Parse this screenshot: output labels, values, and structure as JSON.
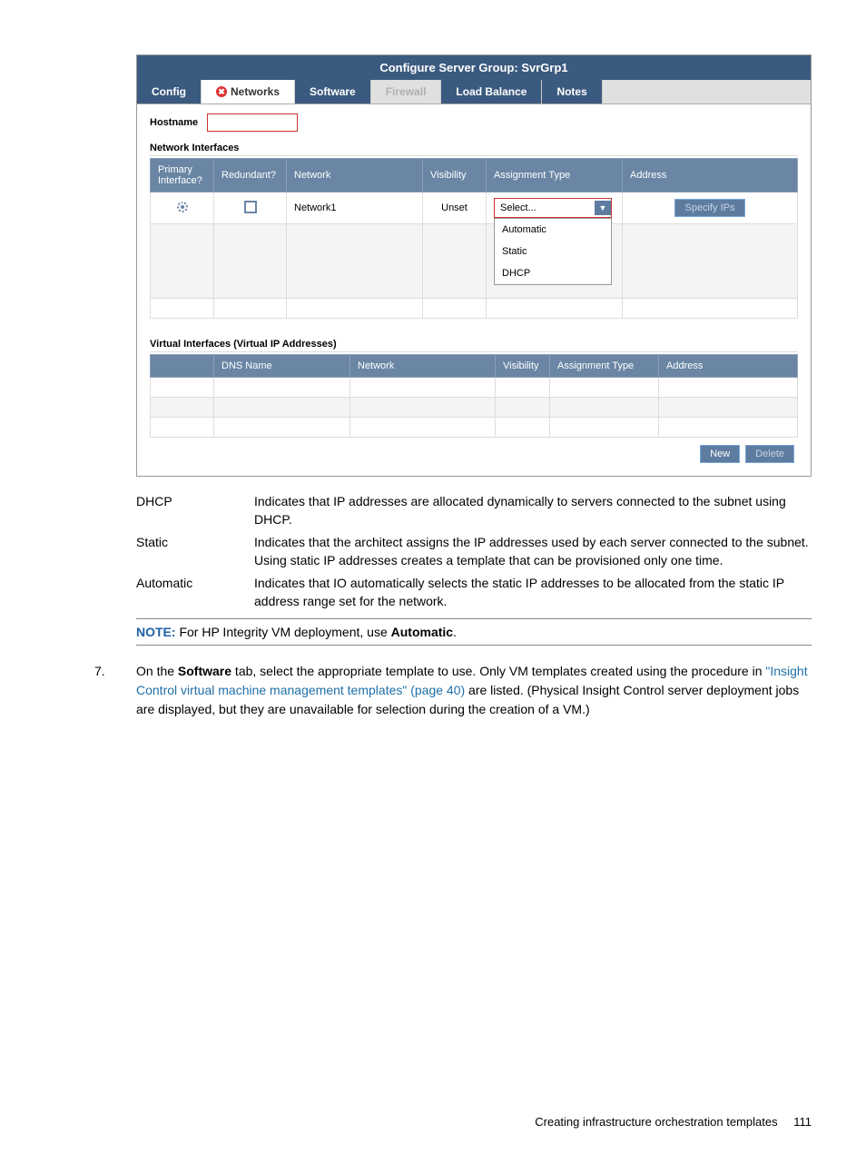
{
  "screenshot": {
    "title": "Configure Server Group: SvrGrp1",
    "tabs": {
      "config": "Config",
      "networks": "Networks",
      "software": "Software",
      "firewall": "Firewall",
      "loadbalance": "Load Balance",
      "notes": "Notes"
    },
    "hostname_label": "Hostname",
    "ni": {
      "title": "Network Interfaces",
      "headers": {
        "primary": "Primary Interface?",
        "redundant": "Redundant?",
        "network": "Network",
        "visibility": "Visibility",
        "atype": "Assignment Type",
        "address": "Address"
      },
      "row": {
        "network": "Network1",
        "visibility": "Unset",
        "select_label": "Select...",
        "options": {
          "auto": "Automatic",
          "static": "Static",
          "dhcp": "DHCP"
        },
        "specify_btn": "Specify IPs"
      }
    },
    "vi": {
      "title": "Virtual Interfaces (Virtual IP Addresses)",
      "headers": {
        "dns": "DNS Name",
        "network": "Network",
        "visibility": "Visibility",
        "atype": "Assignment Type",
        "address": "Address"
      },
      "new_btn": "New",
      "delete_btn": "Delete"
    }
  },
  "defs": {
    "dhcp": {
      "term": "DHCP",
      "desc": "Indicates that IP addresses are allocated dynamically to servers connected to the subnet using DHCP."
    },
    "static": {
      "term": "Static",
      "desc": "Indicates that the architect assigns the IP addresses used by each server connected to the subnet. Using static IP addresses creates a template that can be provisioned only one time."
    },
    "auto": {
      "term": "Automatic",
      "desc": "Indicates that IO automatically selects the static IP addresses to be allocated from the static IP address range set for the network."
    }
  },
  "note": {
    "label": "NOTE:",
    "before": "For HP Integrity VM deployment, use ",
    "bold": "Automatic",
    "after": "."
  },
  "step7": {
    "num": "7.",
    "p1a": "On the ",
    "p1bold": "Software",
    "p1b": " tab, select the appropriate template to use. Only VM templates created using the procedure in ",
    "link": "\"Insight Control virtual machine management templates\" (page 40)",
    "p1c": " are listed. (Physical Insight Control server deployment jobs are displayed, but they are unavailable for selection during the creation of a VM.)"
  },
  "footer": {
    "text": "Creating infrastructure orchestration templates",
    "page": "111"
  }
}
